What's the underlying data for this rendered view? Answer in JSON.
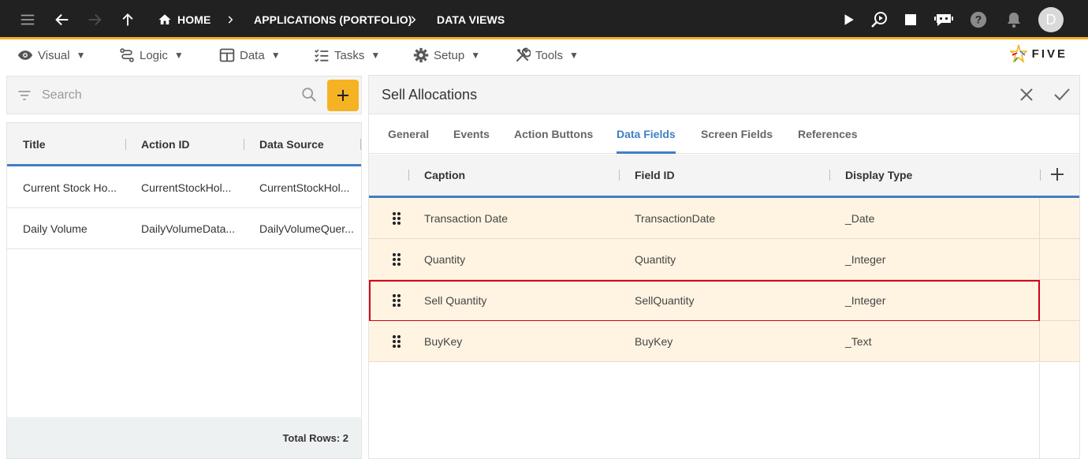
{
  "topbar": {
    "breadcrumbs": [
      "HOME",
      "APPLICATIONS (PORTFOLIO)",
      "DATA VIEWS"
    ],
    "avatar_letter": "D",
    "accent_color": "#f5b324"
  },
  "menus": [
    {
      "label": "Visual",
      "icon": "eye-icon"
    },
    {
      "label": "Logic",
      "icon": "logic-icon"
    },
    {
      "label": "Data",
      "icon": "table-icon"
    },
    {
      "label": "Tasks",
      "icon": "tasks-icon"
    },
    {
      "label": "Setup",
      "icon": "gear-icon"
    },
    {
      "label": "Tools",
      "icon": "tools-icon"
    }
  ],
  "menu_caret": "▼",
  "logo": {
    "text": "FIVE"
  },
  "search": {
    "placeholder": "Search",
    "value": ""
  },
  "list": {
    "columns": [
      "Title",
      "Action ID",
      "Data Source"
    ],
    "rows": [
      [
        "Current Stock Ho...",
        "CurrentStockHol...",
        "CurrentStockHol..."
      ],
      [
        "Daily Volume",
        "DailyVolumeData...",
        "DailyVolumeQuer..."
      ]
    ],
    "total_rows": "Total Rows: 2"
  },
  "form": {
    "title": "Sell Allocations",
    "tabs": [
      "General",
      "Events",
      "Action Buttons",
      "Data Fields",
      "Screen Fields",
      "References"
    ],
    "active_tab": "Data Fields",
    "grid": {
      "columns": [
        "Caption",
        "Field ID",
        "Display Type"
      ],
      "rows": [
        [
          "Transaction Date",
          "TransactionDate",
          "_Date"
        ],
        [
          "Quantity",
          "Quantity",
          "_Integer"
        ],
        [
          "Sell Quantity",
          "SellQuantity",
          "_Integer"
        ],
        [
          "BuyKey",
          "BuyKey",
          "_Text"
        ]
      ],
      "highlighted_row": "Sell Quantity",
      "row_color": "#fff4e2",
      "highlight_color": "#d0021b"
    }
  }
}
